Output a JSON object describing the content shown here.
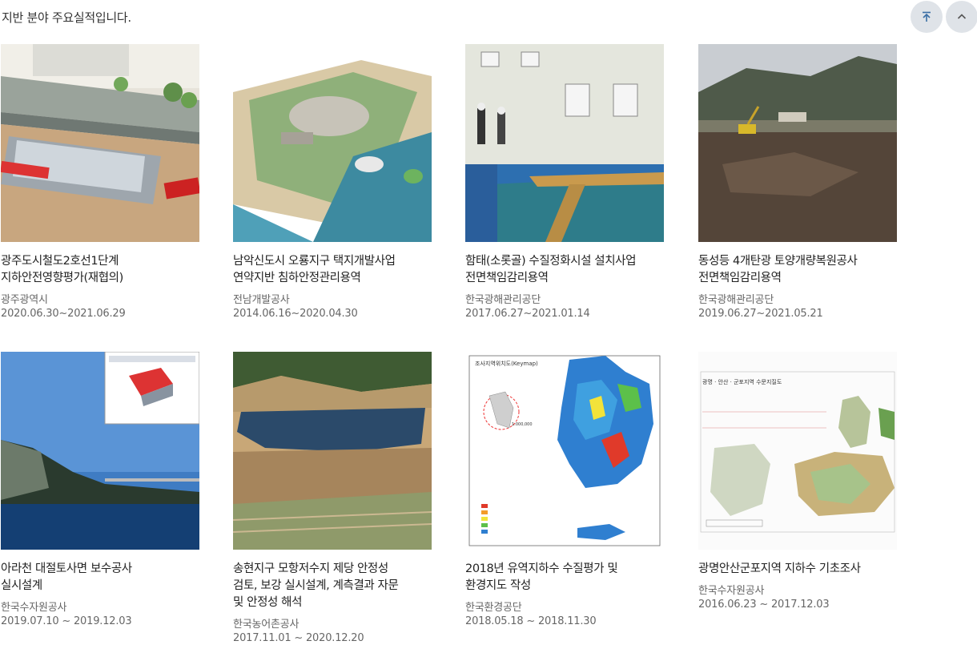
{
  "intro": "지반 분야 주요실적입니다.",
  "controls": {
    "scroll_top_icon": "arrow-to-top-icon",
    "scroll_up_icon": "chevron-up-icon"
  },
  "projects": [
    {
      "title_lines": [
        "광주도시철도2호선1단계",
        "지하안전영향평가(재협의)"
      ],
      "client": "광주광역시",
      "period": "2020.06.30~2021.06.29",
      "thumb": "subway-station-cutaway"
    },
    {
      "title_lines": [
        "남악신도시 오룡지구 택지개발사업",
        "연약지반 침하안정관리용역"
      ],
      "client": "전남개발공사",
      "period": "2014.06.16~2020.04.30",
      "thumb": "new-town-aerial"
    },
    {
      "title_lines": [
        "함태(소롯골) 수질정화시설 설치사업",
        "전면책임감리용역"
      ],
      "client": "한국광해관리공단",
      "period": "2017.06.27~2021.01.14",
      "thumb": "water-treatment-tank"
    },
    {
      "title_lines": [
        "동성등 4개탄광 토양개량복원공사",
        "전면책임감리용역"
      ],
      "client": "한국광해관리공단",
      "period": "2019.06.27~2021.05.21",
      "thumb": "mine-site-excavator"
    },
    {
      "title_lines": [
        "아라천 대절토사면 보수공사",
        "실시설계"
      ],
      "client": "한국수자원공사",
      "period": "2019.07.10 ~ 2019.12.03",
      "thumb": "cut-slope-river"
    },
    {
      "title_lines": [
        "송현지구 모항저수지 제당 안정성",
        "검토, 보강 실시설계, 계측결과 자문",
        "및 안정성 해석"
      ],
      "client": "한국농어촌공사",
      "period": "2017.11.01 ~ 2020.12.20",
      "thumb": "reservoir-aerial"
    },
    {
      "title_lines": [
        "2018년 유역지하수 수질평가 및",
        "환경지도 작성"
      ],
      "client": "한국환경공단",
      "period": "2018.05.18 ~ 2018.11.30",
      "thumb": "groundwater-quality-map"
    },
    {
      "title_lines": [
        "광명안산군포지역 지하수 기초조사"
      ],
      "client": "한국수자원공사",
      "period": "2016.06.23 ~ 2017.12.03",
      "thumb": "hydrogeology-map"
    }
  ],
  "map_labels": {
    "keymap_title": "조사지역위치도(Keymap)",
    "keymap_scale": "1:000,000",
    "hydro_title": "광명 · 안산 · 군포지역 수문지질도"
  }
}
